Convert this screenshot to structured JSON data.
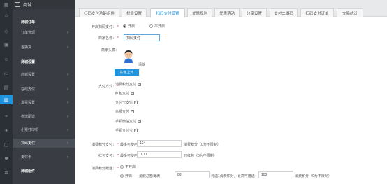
{
  "header": {
    "title": "商城"
  },
  "sidebar": {
    "items": [
      {
        "label": "商城订单",
        "type": "section"
      },
      {
        "label": "订单管理",
        "chev": "›"
      },
      {
        "label": "退换货",
        "chev": "›"
      },
      {
        "label": "商城设置",
        "type": "section"
      },
      {
        "label": "商城设置",
        "chev": "›"
      },
      {
        "label": "在线支付",
        "chev": "›"
      },
      {
        "label": "发票设置",
        "chev": "›"
      },
      {
        "label": "物流配送",
        "chev": "›"
      },
      {
        "label": "小票打印机",
        "chev": "›"
      },
      {
        "label": "扫码支付",
        "chev": "›",
        "active": true
      },
      {
        "label": "支付卡",
        "chev": "›"
      },
      {
        "label": "商城组件",
        "type": "section"
      }
    ]
  },
  "tabs": [
    {
      "label": "扫码支付功能组件"
    },
    {
      "label": "栏目设置"
    },
    {
      "label": "扫码支付设置",
      "active": true
    },
    {
      "label": "优惠规则"
    },
    {
      "label": "优惠活动"
    },
    {
      "label": "分享设置"
    },
    {
      "label": "支付二维码"
    },
    {
      "label": "扫码支付订单"
    },
    {
      "label": "交易统计"
    }
  ],
  "form": {
    "enable": {
      "label": "开启扫码支付：",
      "on": "开启",
      "off": "不开启"
    },
    "merchant_name": {
      "label": "商家名称：",
      "value": "扫码支付"
    },
    "merchant_avatar": {
      "label": "商家头像：",
      "clear": "清除",
      "upload": "头像上传"
    },
    "pay_methods": {
      "label": "支付方式：",
      "options": [
        "消费积分支付",
        "红包支付",
        "支付卡支付",
        "余额支付",
        "手机微信支付",
        "手机支付宝"
      ]
    },
    "points_pay": {
      "label": "消费积分支付：",
      "prefix": "最多可使用",
      "value": "134",
      "suffix": "消费积分（0为不限制）"
    },
    "redpack_pay": {
      "label": "红包支付：",
      "prefix": "最多可使用",
      "value": "0.00",
      "suffix": "元红包（0为不限制）"
    },
    "points_gift": {
      "label": "消费积分赠送：",
      "off": "不开启",
      "on": "开启",
      "rule_prefix": "消费总额每满",
      "rule_value": "88",
      "rule_mid": "元送1消费积分，最高可赠送",
      "rule_max": "100",
      "rule_suffix": "消费积分（0为不限制）"
    }
  },
  "colors": {
    "accent": "#1e93de",
    "sidebar": "#393d43",
    "rail": "#2b3036"
  }
}
